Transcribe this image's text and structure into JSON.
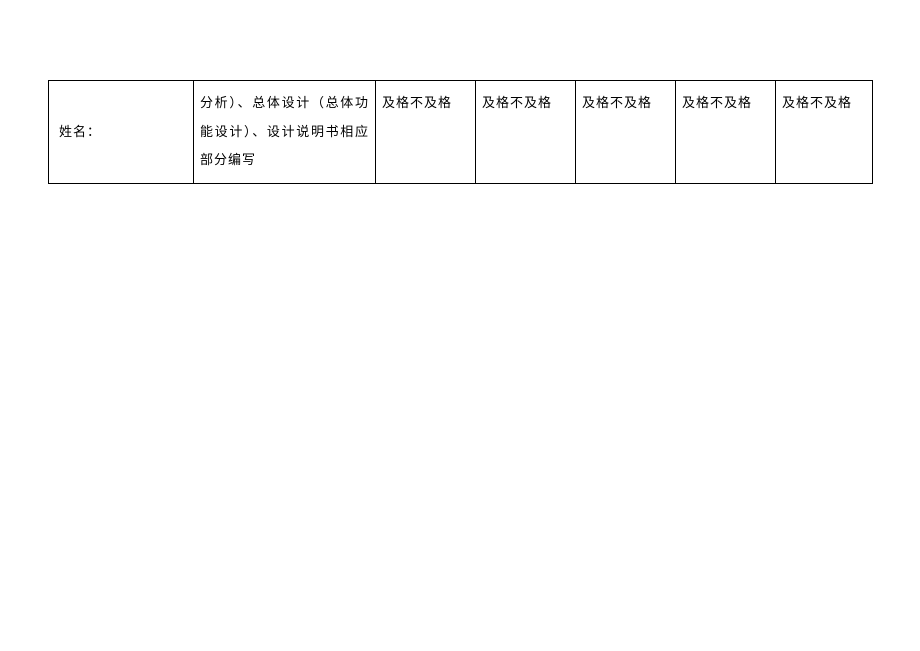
{
  "table": {
    "row": {
      "col1": "姓名：",
      "col2": "分析）、总体设计（总体功能设计）、设计说明书相应部分编写",
      "col3": "及格不及格",
      "col4": "及格不及格",
      "col5": "及格不及格",
      "col6": "及格不及格",
      "col7": "及格不及格"
    }
  }
}
